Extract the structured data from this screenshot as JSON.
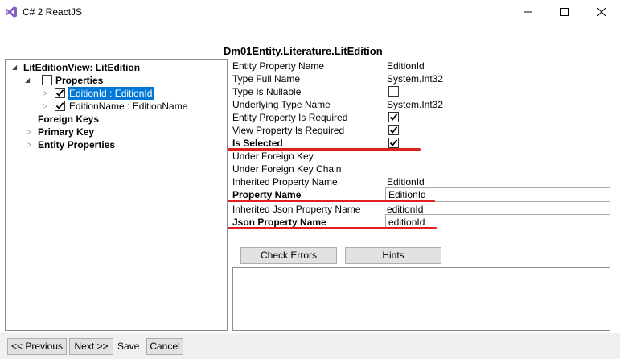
{
  "window": {
    "title": "C# 2 ReactJS",
    "minimize_icon": "minimize-icon",
    "maximize_icon": "maximize-icon",
    "close_icon": "close-icon"
  },
  "tree": {
    "root": "LitEditionView: LitEdition",
    "properties": "Properties",
    "items": [
      {
        "label": "EditionId : EditionId",
        "checked": true,
        "selected": true
      },
      {
        "label": "EditionName : EditionName",
        "checked": true,
        "selected": false
      }
    ],
    "foreign_keys": "Foreign Keys",
    "primary_key": "Primary Key",
    "entity_properties": "Entity Properties"
  },
  "detail": {
    "header": "Dm01Entity.Literature.LitEdition",
    "rows": {
      "entity_property_name": {
        "label": "Entity Property Name",
        "value": "EditionId"
      },
      "type_full_name": {
        "label": "Type Full Name",
        "value": "System.Int32"
      },
      "type_is_nullable": {
        "label": "Type Is Nullable",
        "checked": false
      },
      "underlying_type_name": {
        "label": "Underlying Type Name",
        "value": "System.Int32"
      },
      "entity_property_required": {
        "label": "Entity Property Is Required",
        "checked": true
      },
      "view_property_required": {
        "label": "View Property Is Required",
        "checked": true
      },
      "is_selected": {
        "label": "Is Selected",
        "checked": true
      },
      "under_foreign_key": {
        "label": "Under Foreign Key"
      },
      "under_foreign_key_chain": {
        "label": "Under Foreign Key Chain"
      },
      "inherited_property_name": {
        "label": "Inherited Property Name",
        "value": "EditionId"
      },
      "property_name": {
        "label": "Property Name",
        "value": "EditionId"
      },
      "inherited_json_property_name": {
        "label": "Inherited Json Property Name",
        "value": "editionId"
      },
      "json_property_name": {
        "label": "Json Property Name",
        "value": "editionId"
      }
    },
    "check_errors_label": "Check Errors",
    "hints_label": "Hints"
  },
  "footer": {
    "previous_label": "<< Previous",
    "next_label": "Next >>",
    "save_label": "Save",
    "cancel_label": "Cancel"
  },
  "colors": {
    "selection": "#0078d7",
    "annotation_red": "#e0201e",
    "button_bg": "#e1e1e1"
  }
}
